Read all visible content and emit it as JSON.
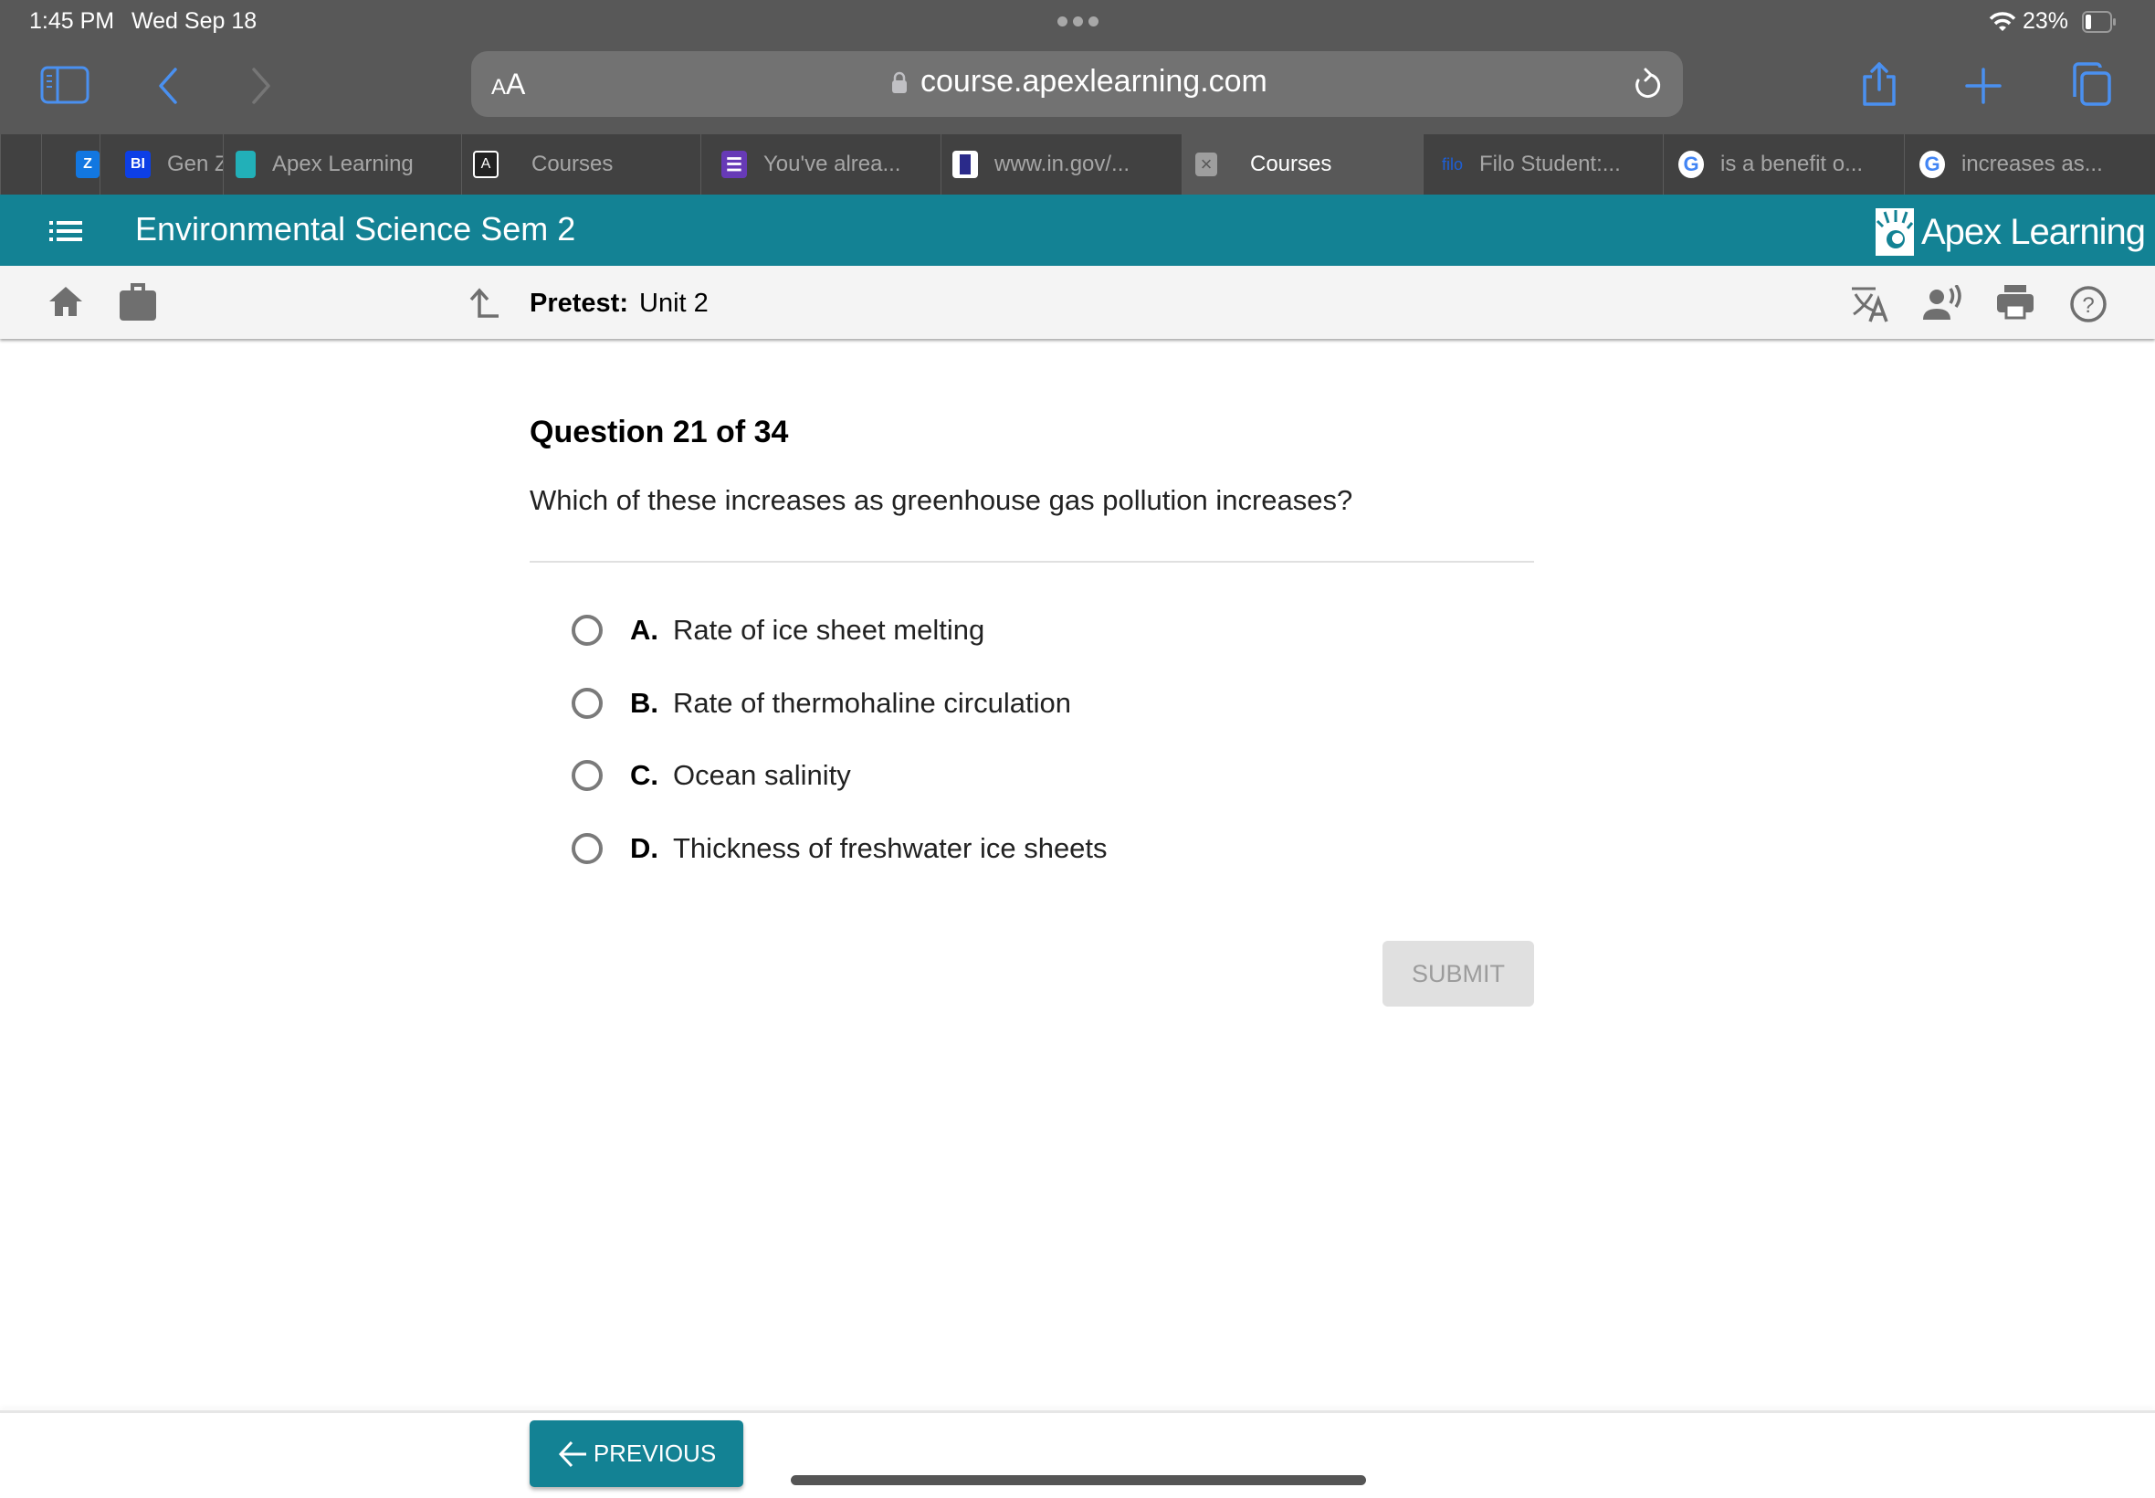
{
  "status_bar": {
    "time": "1:45 PM",
    "date": "Wed Sep 18",
    "battery_percent": "23%",
    "battery_level": 0.23
  },
  "browser": {
    "text_size_label_small": "A",
    "text_size_label_large": "A",
    "url": "course.apexlearning.com",
    "accent_color": "#4a90f0",
    "tabs": [
      {
        "label": "",
        "favicon": "zillow-icon",
        "active": false
      },
      {
        "label": "Gen Z",
        "favicon": "bi-icon",
        "favicon_text": "BI",
        "active": false
      },
      {
        "label": "Apex Learning",
        "favicon": "apex-icon",
        "active": false
      },
      {
        "label": "Courses",
        "favicon": "a-icon",
        "favicon_text": "A",
        "active": false
      },
      {
        "label": "You've alrea...",
        "favicon": "forms-icon",
        "active": false
      },
      {
        "label": "www.in.gov/...",
        "favicon": "indiana-icon",
        "active": false
      },
      {
        "label": "Courses",
        "favicon": "close-icon",
        "favicon_text": "×",
        "active": true
      },
      {
        "label": "Filo Student:...",
        "favicon": "filo-icon",
        "favicon_text": "filo",
        "active": false
      },
      {
        "label": "is a benefit o...",
        "favicon": "google-icon",
        "favicon_text": "G",
        "active": false
      },
      {
        "label": "increases as...",
        "favicon": "google-icon",
        "favicon_text": "G",
        "active": false
      }
    ]
  },
  "app": {
    "course_title": "Environmental Science Sem 2",
    "brand": "Apex Learning",
    "brand_color": "#138294",
    "breadcrumb_label": "Pretest:",
    "breadcrumb_value": "Unit 2"
  },
  "question": {
    "title": "Question 21 of 34",
    "text": "Which of these increases as greenhouse gas pollution increases?",
    "options": [
      {
        "letter": "A.",
        "text": "Rate of ice sheet melting",
        "selected": false
      },
      {
        "letter": "B.",
        "text": "Rate of thermohaline circulation",
        "selected": false
      },
      {
        "letter": "C.",
        "text": "Ocean salinity",
        "selected": false
      },
      {
        "letter": "D.",
        "text": "Thickness of freshwater ice sheets",
        "selected": false
      }
    ],
    "submit_label": "SUBMIT",
    "submit_enabled": false
  },
  "footer": {
    "previous_label": "PREVIOUS"
  }
}
